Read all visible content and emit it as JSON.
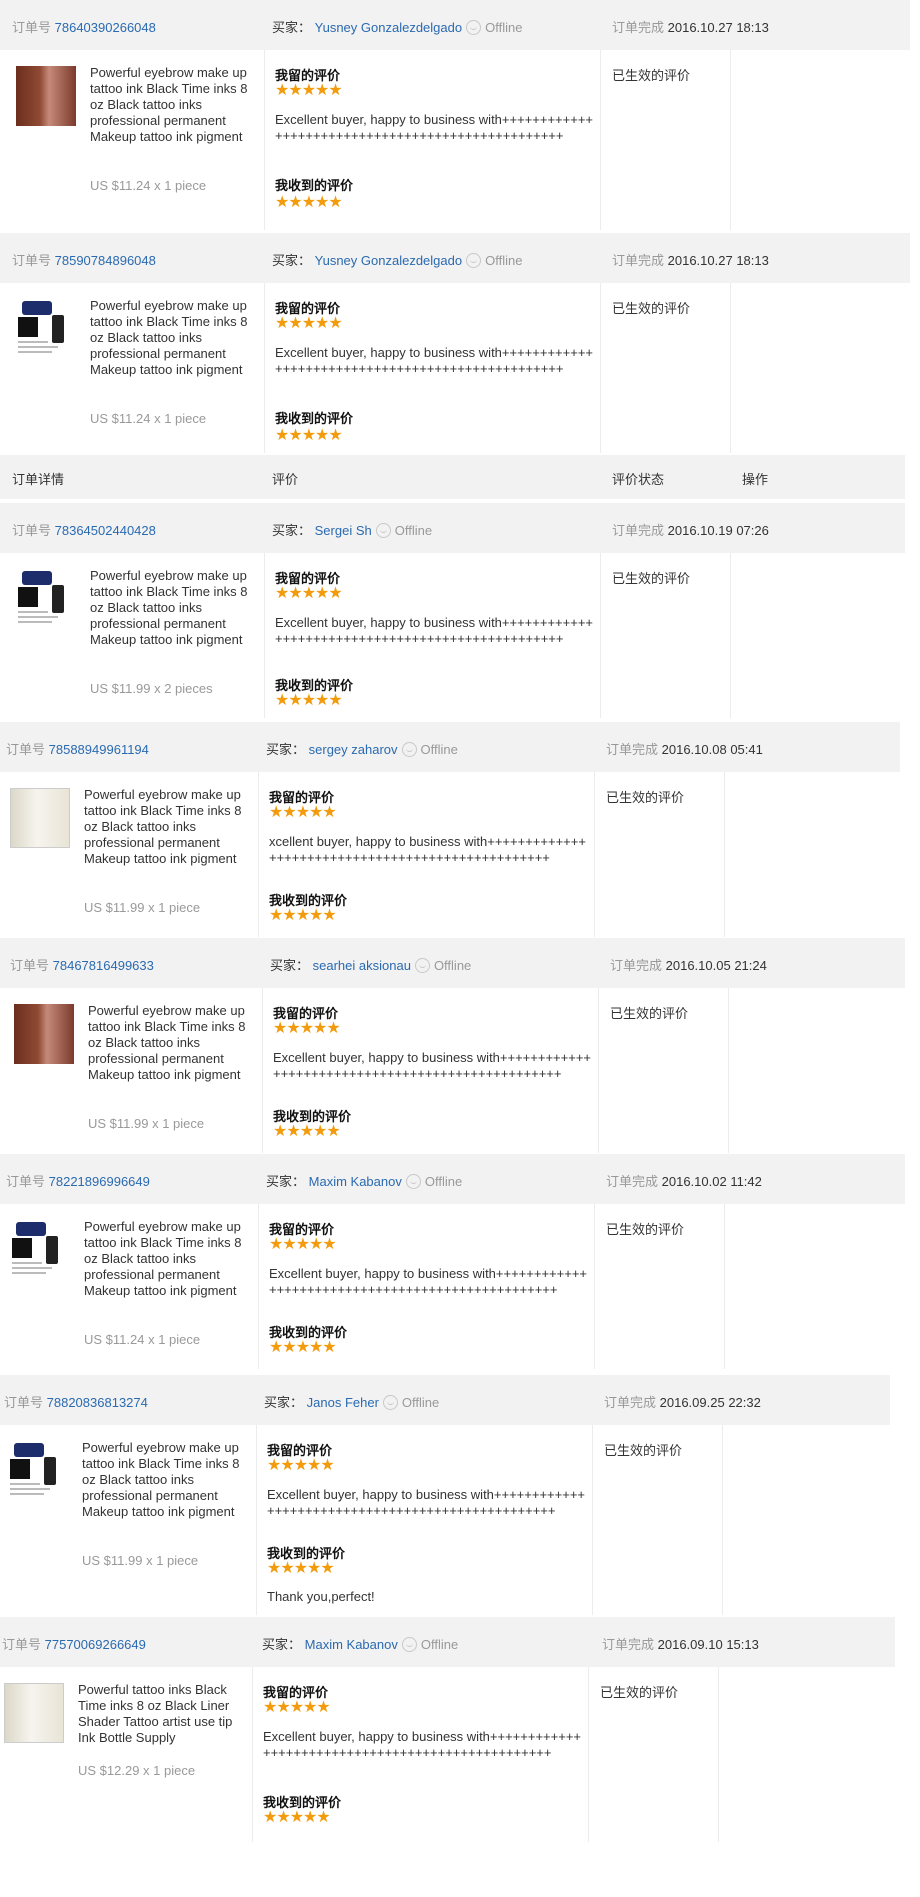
{
  "labels": {
    "order_no": "订单号",
    "buyer": "买家：",
    "offline": "Offline",
    "completed": "订单完成",
    "my_review": "我留的评价",
    "received_review": "我收到的评价",
    "review_status": "已生效的评价",
    "stars": "★★★★★"
  },
  "table_header": {
    "order_detail": "订单详情",
    "review": "评价",
    "review_state": "评价状态",
    "actions": "操作"
  },
  "orders": [
    {
      "order_id": "78640390266048",
      "buyer": "Yusney Gonzalezdelgado",
      "date": "2016.10.27 18:13",
      "product": "Powerful eyebrow make up tattoo ink Black Time inks 8 oz Black tattoo inks professional permanent Makeup tattoo ink pigment",
      "price": "US $11.24 x 1 piece",
      "my_comment": "Excellent buyer, happy to business with++++++++++++++++++++++++++++++++++++++++++++++++++",
      "received_comment": ""
    },
    {
      "order_id": "78590784896048",
      "buyer": "Yusney Gonzalezdelgado",
      "date": "2016.10.27 18:13",
      "product": "Powerful eyebrow make up tattoo ink Black Time inks 8 oz Black tattoo inks professional permanent Makeup tattoo ink pigment",
      "price": "US $11.24 x 1 piece",
      "my_comment": "Excellent buyer, happy to business with++++++++++++++++++++++++++++++++++++++++++++++++++",
      "received_comment": ""
    },
    {
      "order_id": "78364502440428",
      "buyer": "Sergei Sh",
      "date": "2016.10.19 07:26",
      "product": "Powerful eyebrow make up tattoo ink Black Time inks 8 oz Black tattoo inks professional permanent Makeup tattoo ink pigment",
      "price": "US $11.99 x 2 pieces",
      "my_comment": "Excellent buyer, happy to business with++++++++++++++++++++++++++++++++++++++++++++++++++",
      "received_comment": ""
    },
    {
      "order_id": "78588949961194",
      "buyer": "sergey zaharov",
      "date": "2016.10.08 05:41",
      "product": "Powerful eyebrow make up tattoo ink Black Time inks 8 oz Black tattoo inks professional permanent Makeup tattoo ink pigment",
      "price": "US $11.99 x 1 piece",
      "my_comment": "xcellent buyer, happy to business with++++++++++++++++++++++++++++++++++++++++++++++++++",
      "received_comment": ""
    },
    {
      "order_id": "78467816499633",
      "buyer": "searhei aksionau",
      "date": "2016.10.05 21:24",
      "product": "Powerful eyebrow make up tattoo ink Black Time inks 8 oz Black tattoo inks professional permanent Makeup tattoo ink pigment",
      "price": "US $11.99 x 1 piece",
      "my_comment": "Excellent buyer, happy to business with++++++++++++++++++++++++++++++++++++++++++++++++++",
      "received_comment": ""
    },
    {
      "order_id": "78221896996649",
      "buyer": "Maxim Kabanov",
      "date": "2016.10.02 11:42",
      "product": "Powerful eyebrow make up tattoo ink Black Time inks 8 oz Black tattoo inks professional permanent Makeup tattoo ink pigment",
      "price": "US $11.24 x 1 piece",
      "my_comment": "Excellent buyer, happy to business with++++++++++++++++++++++++++++++++++++++++++++++++++",
      "received_comment": ""
    },
    {
      "order_id": "78820836813274",
      "buyer": "Janos Feher",
      "date": "2016.09.25 22:32",
      "product": "Powerful eyebrow make up tattoo ink Black Time inks 8 oz Black tattoo inks professional permanent Makeup tattoo ink pigment",
      "price": "US $11.99 x 1 piece",
      "my_comment": "Excellent buyer, happy to business with++++++++++++++++++++++++++++++++++++++++++++++++++",
      "received_comment": "Thank you,perfect!"
    },
    {
      "order_id": "77570069266649",
      "buyer": "Maxim Kabanov",
      "date": "2016.09.10 15:13",
      "product": "Powerful tattoo inks Black Time inks 8 oz Black Liner Shader Tattoo artist use tip Ink Bottle Supply",
      "price": "US $12.29 x 1 piece",
      "my_comment": "Excellent buyer, happy to business with++++++++++++++++++++++++++++++++++++++++++++++++++",
      "received_comment": ""
    }
  ]
}
